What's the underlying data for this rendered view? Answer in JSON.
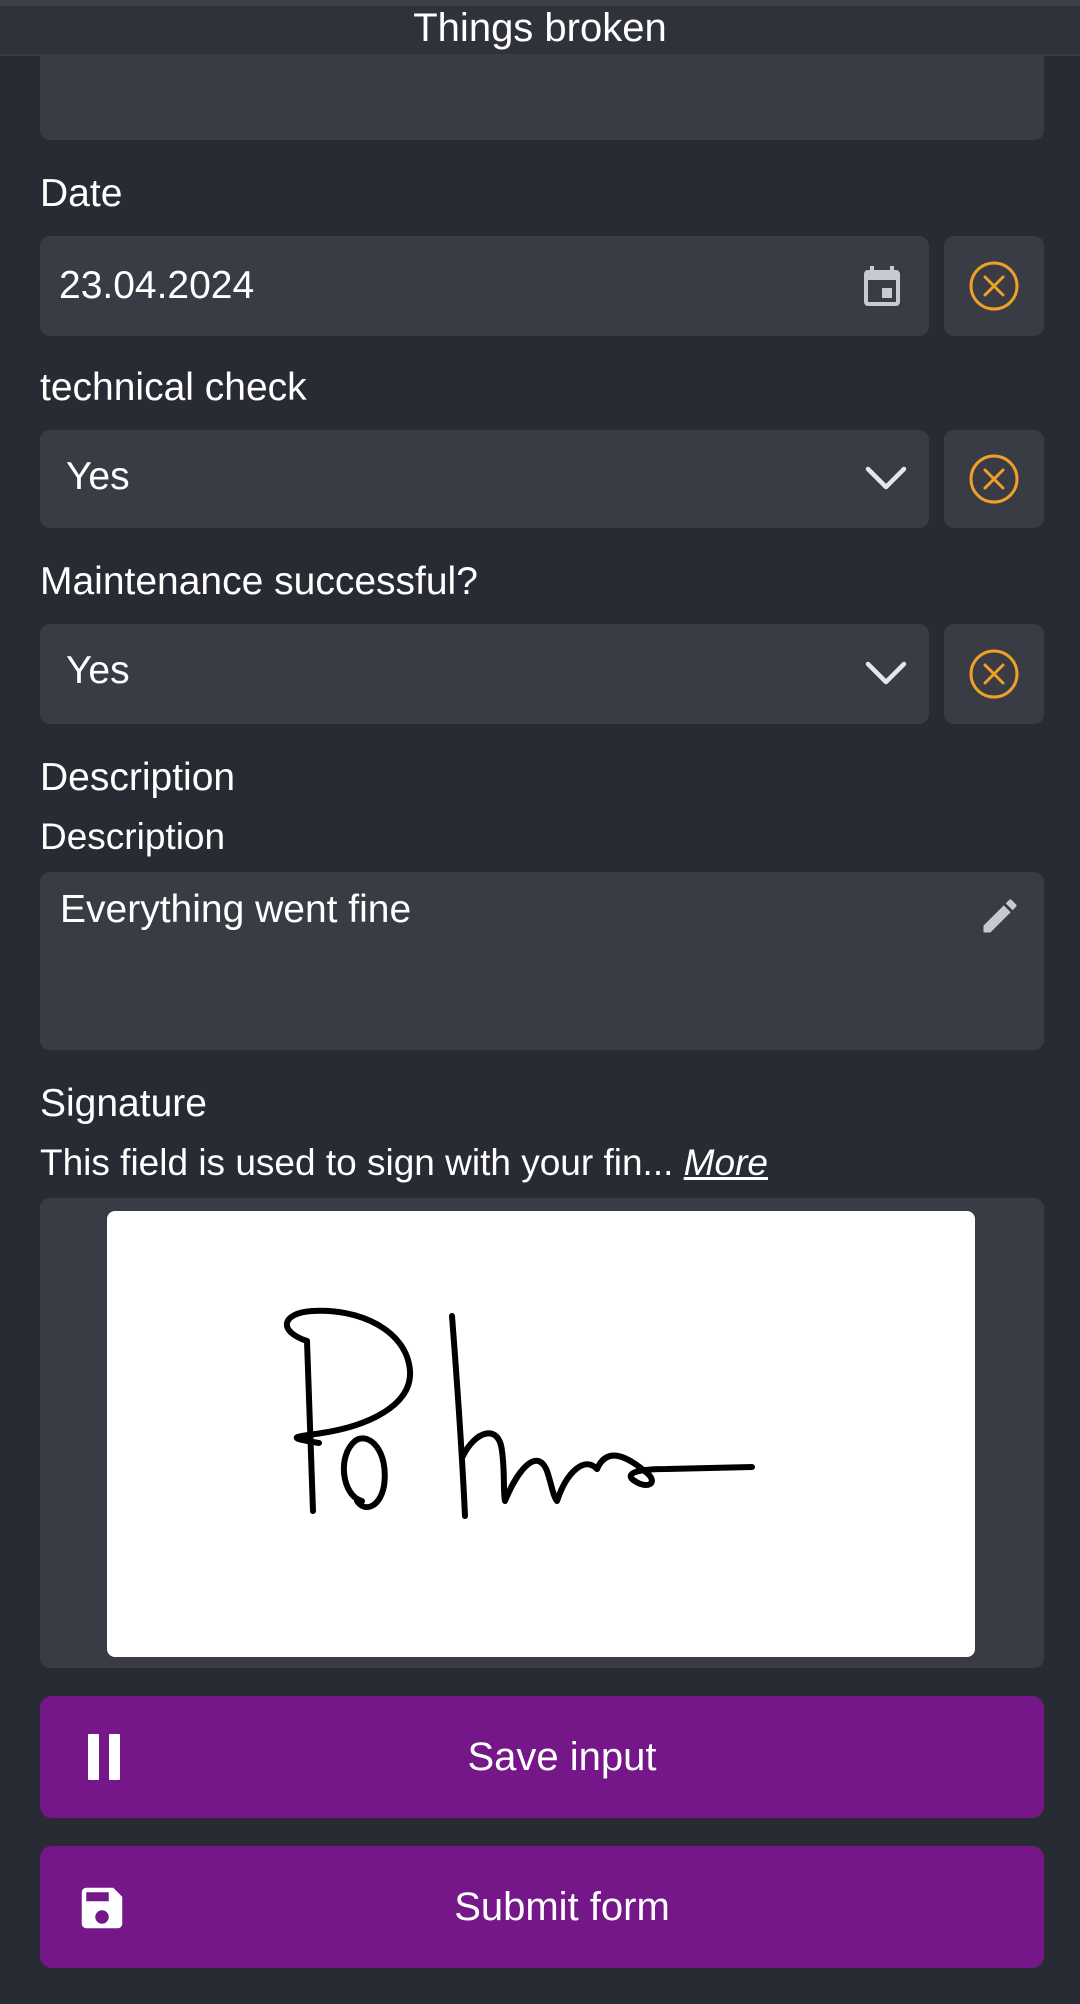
{
  "header": {
    "title": "Things broken"
  },
  "date_field": {
    "label": "Date",
    "value": "23.04.2024",
    "icon": "calendar-icon",
    "clear_icon": "clear-circle-icon"
  },
  "technical_check": {
    "label": "technical check",
    "value": "Yes",
    "icon": "chevron-down-icon"
  },
  "maintenance": {
    "label": "Maintenance successful?",
    "value": "Yes",
    "icon": "chevron-down-icon"
  },
  "description": {
    "section_label": "Description",
    "field_label": "Description",
    "value": "Everything went fine",
    "icon": "pencil-icon"
  },
  "signature": {
    "label": "Signature",
    "hint": "This field is used to sign with your fin...",
    "more_link": "More",
    "signed_name": "Pohn"
  },
  "actions": {
    "save_label": "Save input",
    "save_icon": "pause-icon",
    "submit_label": "Submit form",
    "submit_icon": "floppy-disk-icon"
  },
  "colors": {
    "background": "#292b34",
    "field": "#393b45",
    "accent_orange": "#f0a028",
    "button_purple": "#761789"
  }
}
